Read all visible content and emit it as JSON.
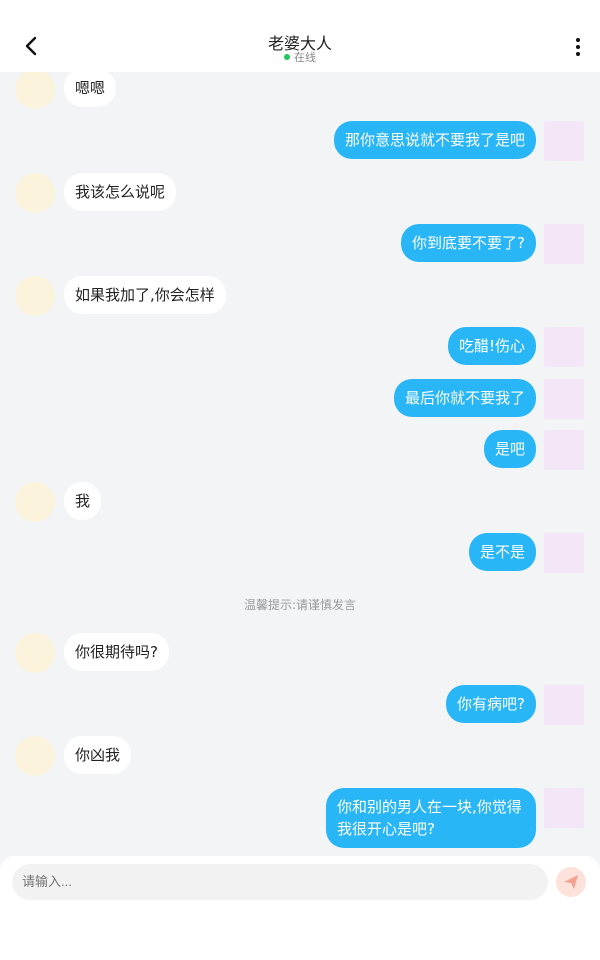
{
  "header": {
    "title": "老婆大人",
    "status": "在线",
    "status_color": "#22c55e"
  },
  "messages": [
    {
      "side": "left",
      "text": "嗯嗯"
    },
    {
      "side": "right",
      "text": "那你意思说就不要我了是吧"
    },
    {
      "side": "left",
      "text": "我该怎么说呢"
    },
    {
      "side": "right",
      "text": "你到底要不要了?"
    },
    {
      "side": "left",
      "text": "如果我加了,你会怎样"
    },
    {
      "side": "right",
      "text": "吃醋!伤心"
    },
    {
      "side": "right",
      "text": "最后你就不要我了"
    },
    {
      "side": "right",
      "text": "是吧"
    },
    {
      "side": "left",
      "text": "我"
    },
    {
      "side": "right",
      "text": "是不是"
    },
    {
      "side": "left",
      "text": "你很期待吗?"
    },
    {
      "side": "right",
      "text": "你有病吧?"
    },
    {
      "side": "left",
      "text": "你凶我"
    },
    {
      "side": "right",
      "text": "你和别的男人在一块,你觉得我很开心是吧?"
    }
  ],
  "system_tip": "温馨提示:请谨慎发言",
  "input": {
    "placeholder": "请输入..."
  },
  "icons": {
    "back": "chevron-left-icon",
    "more": "more-vertical-icon",
    "send": "send-icon",
    "emoji": "emoji-icon",
    "image": "image-icon"
  },
  "colors": {
    "accent": "#29b6f6",
    "send_button": "#fde2dc",
    "send_icon": "#f4a18f"
  }
}
